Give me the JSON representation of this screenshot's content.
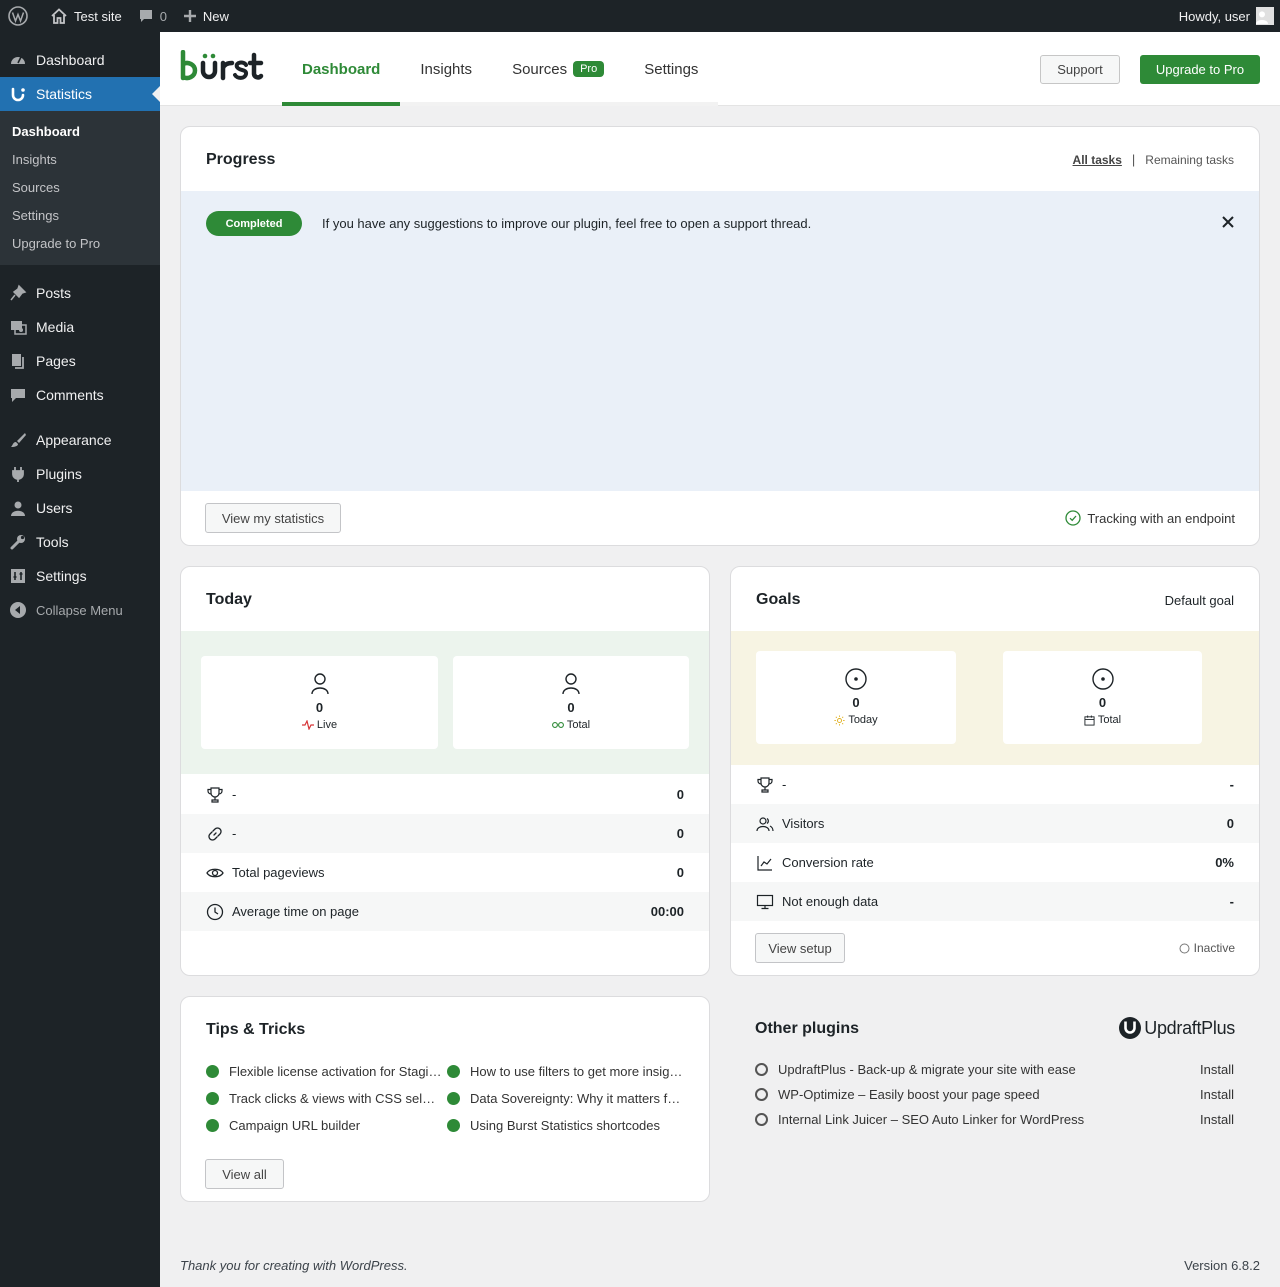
{
  "adminbar": {
    "site_name": "Test site",
    "comments_count": "0",
    "new_label": "New",
    "howdy": "Howdy, user"
  },
  "sidebar": {
    "dashboard": "Dashboard",
    "statistics": "Statistics",
    "sub": [
      "Dashboard",
      "Insights",
      "Sources",
      "Settings",
      "Upgrade to Pro"
    ],
    "items": [
      "Posts",
      "Media",
      "Pages",
      "Comments",
      "Appearance",
      "Plugins",
      "Users",
      "Tools",
      "Settings"
    ],
    "collapse": "Collapse Menu"
  },
  "header": {
    "tabs": [
      "Dashboard",
      "Insights",
      "Sources",
      "Settings"
    ],
    "pro_badge": "Pro",
    "support": "Support",
    "upgrade": "Upgrade to Pro",
    "brand_color": "#2e8a37"
  },
  "progress": {
    "title": "Progress",
    "all_tasks": "All tasks",
    "separator": "|",
    "remaining_tasks": "Remaining tasks",
    "badge": "Completed",
    "message": "If you have any suggestions to improve our plugin, feel free to open a support thread.",
    "view_stats": "View my statistics",
    "tracking": "Tracking with an endpoint"
  },
  "today": {
    "title": "Today",
    "live_value": "0",
    "live_label": "Live",
    "total_value": "0",
    "total_label": "Total",
    "rows": [
      {
        "label": "-",
        "value": "0"
      },
      {
        "label": "-",
        "value": "0"
      },
      {
        "label": "Total pageviews",
        "value": "0"
      },
      {
        "label": "Average time on page",
        "value": "00:00"
      }
    ]
  },
  "goals": {
    "title": "Goals",
    "selector": "Default goal",
    "today_value": "0",
    "today_label": "Today",
    "total_value": "0",
    "total_label": "Total",
    "rows": [
      {
        "label": "-",
        "value": "-"
      },
      {
        "label": "Visitors",
        "value": "0"
      },
      {
        "label": "Conversion rate",
        "value": "0%"
      },
      {
        "label": "Not enough data",
        "value": "-"
      }
    ],
    "view_setup": "View setup",
    "status": "Inactive"
  },
  "tips": {
    "title": "Tips & Tricks",
    "items": [
      "Flexible license activation for Staging",
      "How to use filters to get more insights",
      "Track clicks & views with CSS selectors",
      "Data Sovereignty: Why it matters for you",
      "Campaign URL builder",
      "Using Burst Statistics shortcodes"
    ],
    "view_all": "View all"
  },
  "plugins": {
    "title": "Other plugins",
    "logo_text": "UpdraftPlus",
    "items": [
      {
        "name": "UpdraftPlus - Back-up & migrate your site with ease",
        "action": "Install"
      },
      {
        "name": "WP-Optimize – Easily boost your page speed",
        "action": "Install"
      },
      {
        "name": "Internal Link Juicer – SEO Auto Linker for WordPress",
        "action": "Install"
      }
    ]
  },
  "footer": {
    "thanks": "Thank you for creating with WordPress.",
    "version": "Version 6.8.2"
  }
}
